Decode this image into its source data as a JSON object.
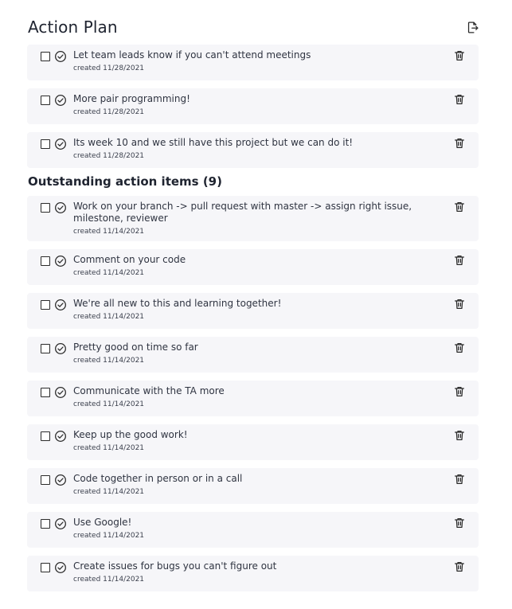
{
  "header": {
    "title": "Action Plan"
  },
  "completed_items": [
    {
      "text": "Let team leads know if you can't attend meetings",
      "created": "created 11/28/2021"
    },
    {
      "text": "More pair programming!",
      "created": "created 11/28/2021"
    },
    {
      "text": "Its week 10 and we still have this project but we can do it!",
      "created": "created 11/28/2021"
    }
  ],
  "outstanding": {
    "heading": "Outstanding action items (9)",
    "items": [
      {
        "text": "Work on your branch -> pull request with master -> assign right issue, milestone, reviewer",
        "created": "created 11/14/2021"
      },
      {
        "text": "Comment on your code",
        "created": "created 11/14/2021"
      },
      {
        "text": "We're all new to this and learning together!",
        "created": "created 11/14/2021"
      },
      {
        "text": "Pretty good on time so far",
        "created": "created 11/14/2021"
      },
      {
        "text": "Communicate with the TA more",
        "created": "created 11/14/2021"
      },
      {
        "text": "Keep up the good work!",
        "created": "created 11/14/2021"
      },
      {
        "text": "Code together in person or in a call",
        "created": "created 11/14/2021"
      },
      {
        "text": "Use Google!",
        "created": "created 11/14/2021"
      },
      {
        "text": "Create issues for bugs you can't figure out",
        "created": "created 11/14/2021"
      }
    ]
  },
  "icons": {
    "export": "export-icon",
    "complete": "check-circle-icon",
    "delete": "trash-icon",
    "checkbox": "checkbox"
  },
  "colors": {
    "card_background": "#f6f6f9",
    "text": "#2f3441",
    "title": "#1f2430"
  }
}
